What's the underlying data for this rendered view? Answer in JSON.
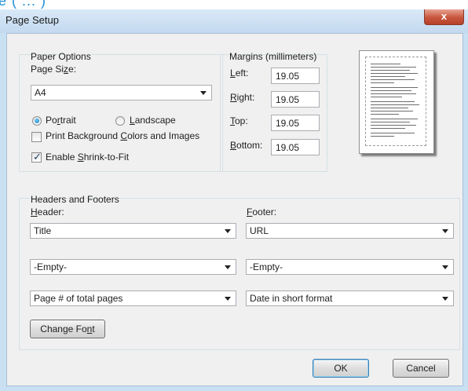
{
  "window": {
    "title": "Page Setup",
    "close_glyph": "x",
    "top_strip_text": "e (  ...  )"
  },
  "paper": {
    "group_label": "Paper Options",
    "size_label": "Page Size:",
    "size_value": "A4",
    "portrait_label": "Portrait",
    "landscape_label": "Landscape",
    "portrait_selected": true,
    "print_bg_label": "Print Background Colors and Images",
    "print_bg_checked": false,
    "shrink_label": "Enable Shrink-to-Fit",
    "shrink_checked": true
  },
  "margins": {
    "group_label": "Margins (millimeters)",
    "left_label": "Left:",
    "left_value": "19.05",
    "right_label": "Right:",
    "right_value": "19.05",
    "top_label": "Top:",
    "top_value": "19.05",
    "bottom_label": "Bottom:",
    "bottom_value": "19.05"
  },
  "headers": {
    "group_label": "Headers and Footers",
    "header_label": "Header:",
    "footer_label": "Footer:",
    "header_1": "Title",
    "header_2": "-Empty-",
    "header_3": "Page # of total pages",
    "footer_1": "URL",
    "footer_2": "-Empty-",
    "footer_3": "Date in short format",
    "change_font": "Change Font"
  },
  "buttons": {
    "ok": "OK",
    "cancel": "Cancel"
  },
  "icons": {
    "close": "close-icon",
    "dropdown": "chevron-down-icon",
    "preview": "page-preview-icon"
  }
}
